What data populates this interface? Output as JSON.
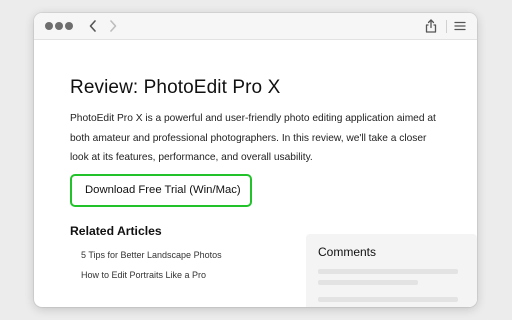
{
  "toolbar": {
    "back_icon": "chevron-left-icon",
    "forward_icon": "chevron-right-icon",
    "share_icon": "share-icon",
    "menu_icon": "hamburger-menu-icon"
  },
  "article": {
    "title": "Review: PhotoEdit Pro X",
    "intro": "PhotoEdit Pro X is a powerful and user-friendly photo editing application aimed at both amateur and professional photographers. In this review, we'll take a closer look at its features, performance, and overall usability.",
    "cta_label": "Download Free Trial (Win/Mac)",
    "cta_highlight_color": "#22c22a"
  },
  "related": {
    "heading": "Related Articles",
    "items": [
      "5 Tips for Better Landscape Photos",
      "How to Edit Portraits Like a Pro"
    ]
  },
  "comments": {
    "heading": "Comments"
  }
}
